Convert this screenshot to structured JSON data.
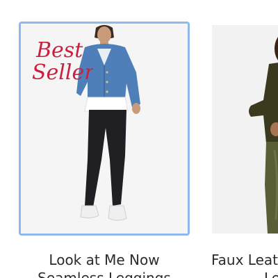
{
  "products": [
    {
      "badge": "Best Seller",
      "badge_line_1": "Best",
      "badge_line_2": "Seller",
      "name_line_1": "Look at Me Now",
      "name_line_2": "Seamless Leggings",
      "highlight_color": "#8fb8ec",
      "badge_color": "#c8203e"
    },
    {
      "name_line_1": "Faux Leat",
      "name_line_2": "Le"
    }
  ]
}
